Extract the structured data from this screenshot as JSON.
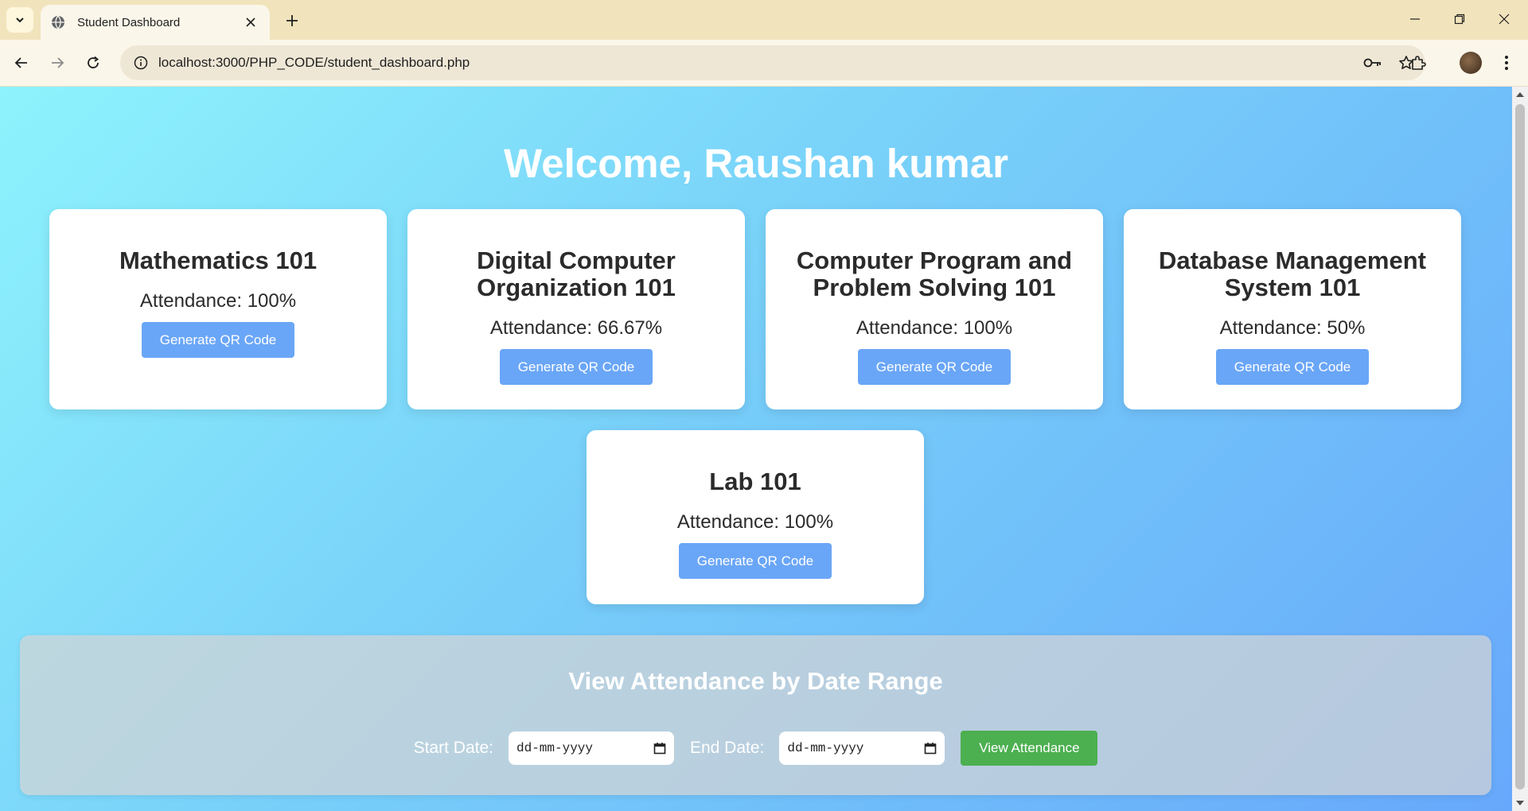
{
  "browser": {
    "tab_title": "Student Dashboard",
    "url": "localhost:3000/PHP_CODE/student_dashboard.php"
  },
  "page": {
    "welcome": "Welcome, Raushan kumar",
    "courses": [
      {
        "name": "Mathematics 101",
        "attendance": "Attendance: 100%",
        "button": "Generate QR Code"
      },
      {
        "name": "Digital Computer Organization 101",
        "attendance": "Attendance: 66.67%",
        "button": "Generate QR Code"
      },
      {
        "name": "Computer Program and Problem Solving 101",
        "attendance": "Attendance: 100%",
        "button": "Generate QR Code"
      },
      {
        "name": "Database Management System 101",
        "attendance": "Attendance: 50%",
        "button": "Generate QR Code"
      },
      {
        "name": "Lab 101",
        "attendance": "Attendance: 100%",
        "button": "Generate QR Code"
      }
    ],
    "date_range": {
      "title": "View Attendance by Date Range",
      "start_label": "Start Date:",
      "start_value": "dd-mm-yyyy",
      "end_label": "End Date:",
      "end_value": "dd-mm-yyyy",
      "button": "View Attendance"
    }
  },
  "colors": {
    "primary_button": "#6aa6f7",
    "view_button": "#4caf50",
    "gradient_start": "#8ef3fc",
    "gradient_end": "#67a8fb"
  }
}
